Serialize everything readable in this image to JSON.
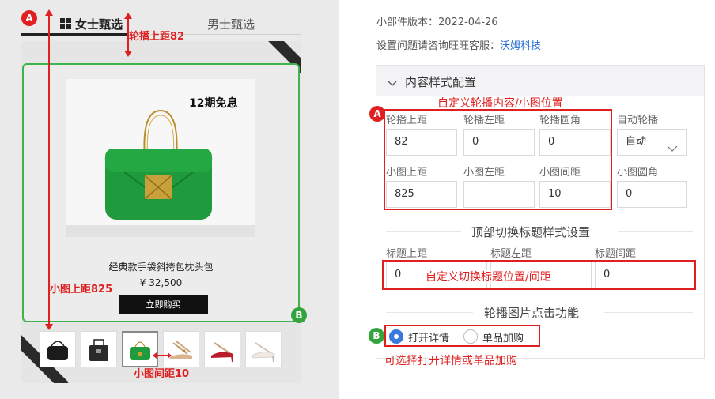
{
  "colors": {
    "accent": "#2a6fd6",
    "annotation_red": "#e02020",
    "annotation_green": "#33a43e"
  },
  "annotations": {
    "badge_a": "A",
    "badge_b": "B",
    "carousel_top": "轮播上距82",
    "thumb_top": "小图上距825",
    "thumb_gap": "小图间距10",
    "custom_carousel": "自定义轮播内容/小图位置",
    "custom_tab": "自定义切换标题位置/间距",
    "choose_detail": "可选择打开详情或单品加购"
  },
  "preview": {
    "tabs": [
      {
        "label": "女士甄选",
        "icon": "grid-icon"
      },
      {
        "label": "男士甄选"
      }
    ],
    "promo": "12期免息",
    "product_name": "经典款手袋斜挎包枕头包",
    "price": "¥ 32,500",
    "buy_button": "立即购买",
    "thumbnails": [
      "black-bag",
      "black-tote",
      "green-bag",
      "studded-sandal",
      "red-pump",
      "white-pump"
    ],
    "selected_thumb": 2
  },
  "config": {
    "version_label": "小部件版本：2022-04-26",
    "support_label": "设置问题请咨询旺旺客服：",
    "support_link": "沃姆科技",
    "section_title": "内容样式配置",
    "row1": [
      {
        "label": "轮播上距",
        "value": "82"
      },
      {
        "label": "轮播左距",
        "value": "0"
      },
      {
        "label": "轮播圆角",
        "value": "0"
      },
      {
        "label": "自动轮播",
        "value": "自动"
      }
    ],
    "row2": [
      {
        "label": "小图上距",
        "value": "825"
      },
      {
        "label": "小图左距",
        "value": ""
      },
      {
        "label": "小图间距",
        "value": "10"
      },
      {
        "label": "小图圆角",
        "value": "0"
      }
    ],
    "tab_section_title": "顶部切换标题样式设置",
    "tab_fields": [
      {
        "label": "标题上距",
        "value": "0"
      },
      {
        "label": "标题左距",
        "value": ""
      },
      {
        "label": "标题间距",
        "value": "0"
      }
    ],
    "click_section_title": "轮播图片点击功能",
    "click_options": [
      "打开详情",
      "单品加购"
    ],
    "click_selected": 0
  }
}
